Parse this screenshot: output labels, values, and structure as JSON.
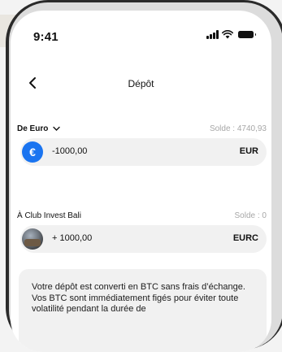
{
  "status_bar": {
    "time": "9:41"
  },
  "nav": {
    "back_glyph": "‹",
    "title": "Dépôt"
  },
  "from": {
    "label": "De Euro",
    "chevron": "⌄",
    "balance": "Solde : 4740,93",
    "icon_glyph": "€",
    "amount": "-1000,00",
    "currency": "EUR"
  },
  "to": {
    "label": "À Club Invest Bali",
    "balance": "Solde : 0",
    "amount": "+ 1000,00",
    "currency": "EURC"
  },
  "info": {
    "text": "Votre dépôt est converti en BTC sans frais d’échange. Vos BTC sont immédiatement figés pour éviter toute volatilité pendant la durée de"
  },
  "colors": {
    "euro_icon": "#1a74f0",
    "balance_text": "#a7a7a7",
    "pill_bg": "#f1f1f1"
  },
  "icons": {
    "back": "chevron-left-icon",
    "from_coin": "euro-icon",
    "to_coin": "club-avatar"
  }
}
